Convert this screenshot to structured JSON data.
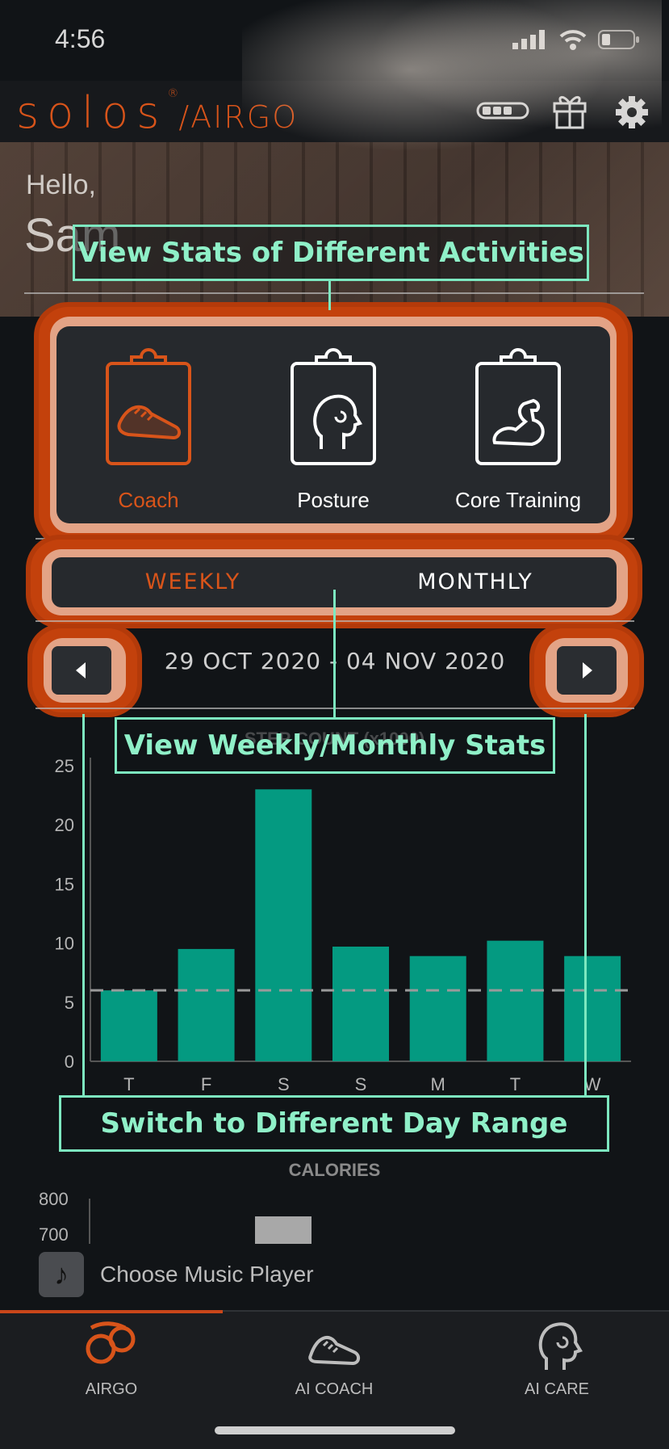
{
  "status_bar": {
    "time": "4:56",
    "signal_icon": "signal-bars-icon",
    "wifi_icon": "wifi-icon",
    "battery_icon": "battery-icon"
  },
  "header": {
    "logo_main": "solos",
    "logo_registered": "®",
    "logo_sub": "/AIRGO",
    "device_battery_icon": "device-battery-icon",
    "gift_icon": "gift-icon",
    "settings_icon": "gear-icon"
  },
  "greeting": {
    "hello": "Hello,",
    "name": "Sam"
  },
  "activities": [
    {
      "label": "Coach",
      "icon": "shoe-clipboard-icon",
      "active": true
    },
    {
      "label": "Posture",
      "icon": "head-clipboard-icon",
      "active": false
    },
    {
      "label": "Core Training",
      "icon": "muscle-clipboard-icon",
      "active": false
    }
  ],
  "period": {
    "weekly": "WEEKLY",
    "monthly": "MONTHLY",
    "selected": "WEEKLY"
  },
  "date_range": {
    "label": "29 OCT 2020 - 04 NOV 2020",
    "prev_icon": "caret-left-icon",
    "next_icon": "caret-right-icon"
  },
  "callouts": {
    "activities": "View Stats of Different Activities",
    "period": "View Weekly/Monthly Stats",
    "range": "Switch to Different Day Range"
  },
  "chart_data": {
    "type": "bar",
    "title": "STEP COUNT (x1000)",
    "categories": [
      "T",
      "F",
      "S",
      "S",
      "M",
      "T",
      "W"
    ],
    "values": [
      6,
      9.5,
      23,
      9.7,
      8.9,
      10.2,
      8.9
    ],
    "ylim": [
      0,
      25
    ],
    "yticks": [
      "0",
      "5",
      "10",
      "15",
      "20",
      "25"
    ],
    "reference_line": 6,
    "colors": {
      "bar": "#049a81",
      "reference": "#9a9a9a",
      "axis": "#555555"
    }
  },
  "calories": {
    "title": "CALORIES",
    "ticks": [
      "800",
      "700"
    ]
  },
  "music": {
    "label": "Choose Music Player",
    "icon": "music-note-icon"
  },
  "bottom_nav": [
    {
      "label": "AIRGO",
      "icon": "airgo-logo-icon",
      "active": true
    },
    {
      "label": "AI COACH",
      "icon": "shoe-icon",
      "active": false
    },
    {
      "label": "AI CARE",
      "icon": "head-icon",
      "active": false
    }
  ],
  "colors": {
    "accent": "#d8541a",
    "teal": "#049a81",
    "callout": "#7de8c0"
  }
}
